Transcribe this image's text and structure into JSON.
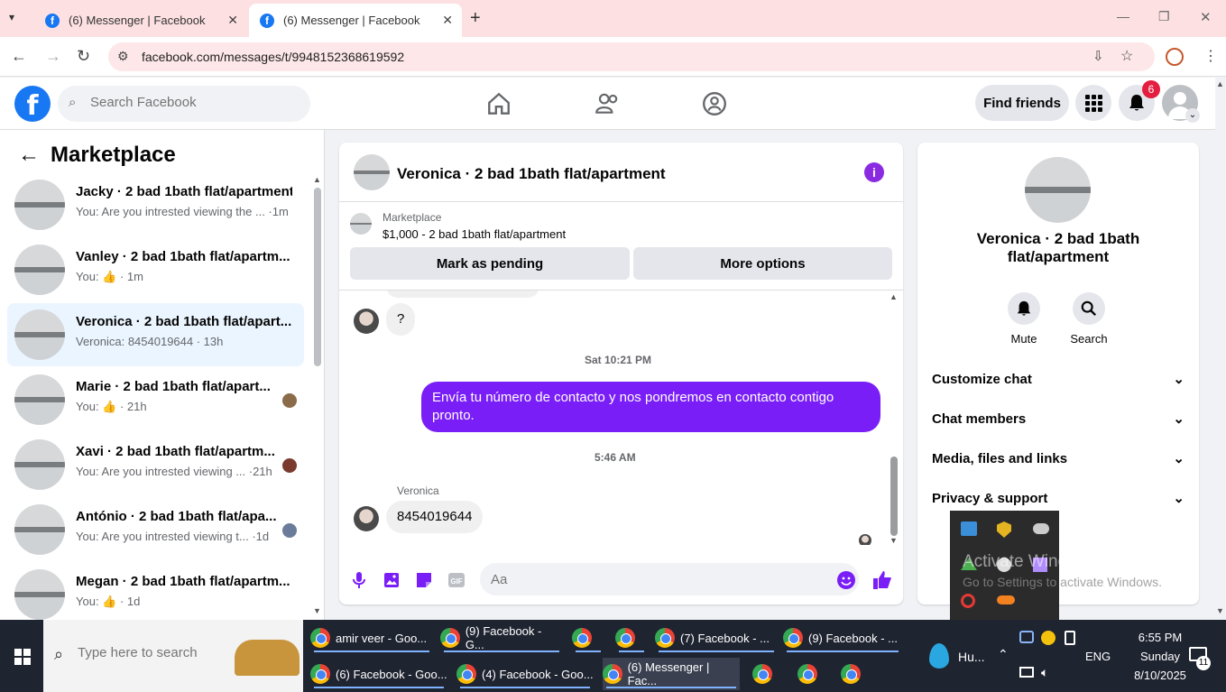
{
  "browser": {
    "tabs": [
      {
        "title": "(6) Messenger | Facebook"
      },
      {
        "title": "(6) Messenger | Facebook"
      }
    ],
    "url": "facebook.com/messages/t/9948152368619592"
  },
  "fb_nav": {
    "search_placeholder": "Search Facebook",
    "find_friends": "Find friends",
    "notif_count": "6"
  },
  "left": {
    "title": "Marketplace",
    "conversations": [
      {
        "name": "Jacky · 2 bad 1bath flat/apartment",
        "sub": "You: Are you intrested viewing the ... ·1m"
      },
      {
        "name": "Vanley · 2 bad 1bath flat/apartm...",
        "sub": "You: 👍 · 1m"
      },
      {
        "name": "Veronica · 2 bad 1bath flat/apart...",
        "sub": "Veronica: 8454019644 · 13h"
      },
      {
        "name": "Marie · 2 bad 1bath flat/apart...",
        "sub": "You: 👍 · 21h"
      },
      {
        "name": "Xavi · 2 bad 1bath flat/apartm...",
        "sub": "You: Are you intrested viewing ... ·21h"
      },
      {
        "name": "António · 2 bad 1bath flat/apa...",
        "sub": "You: Are you intrested viewing t... ·1d"
      },
      {
        "name": "Megan · 2 bad 1bath flat/apartm...",
        "sub": "You: 👍 · 1d"
      }
    ]
  },
  "chat": {
    "title": "Veronica · 2 bad 1bath flat/apartment",
    "marketplace_label": "Marketplace",
    "listing": "$1,000 - 2 bad 1bath flat/apartment",
    "mark_pending": "Mark as pending",
    "more_options": "More options",
    "messages": {
      "q": "?",
      "ts1": "Sat 10:21 PM",
      "out1": "Envía tu número de contacto y nos pondremos en contacto contigo pronto.",
      "ts2": "5:46 AM",
      "sender": "Veronica",
      "in1": "8454019644"
    },
    "composer_placeholder": "Aa"
  },
  "right": {
    "name": "Veronica · 2 bad 1bath flat/apartment",
    "mute": "Mute",
    "search": "Search",
    "rows": [
      "Customize chat",
      "Chat members",
      "Media, files and links",
      "Privacy & support"
    ]
  },
  "watermark": {
    "line1": "Activate Windows",
    "line2": "Go to Settings to activate Windows."
  },
  "taskbar": {
    "search_placeholder": "Type here to search",
    "items_top": [
      "amir veer - Goo...",
      "(9) Facebook - G...",
      "(7) Facebook - ...",
      "(9) Facebook - ..."
    ],
    "items_bottom": [
      "(6) Facebook - Goo...",
      "(4) Facebook - Goo...",
      "(6) Messenger | Fac..."
    ],
    "weather": "Hu...",
    "lang": "ENG",
    "time": "6:55 PM",
    "day": "Sunday",
    "date": "8/10/2025",
    "notif": "11"
  }
}
